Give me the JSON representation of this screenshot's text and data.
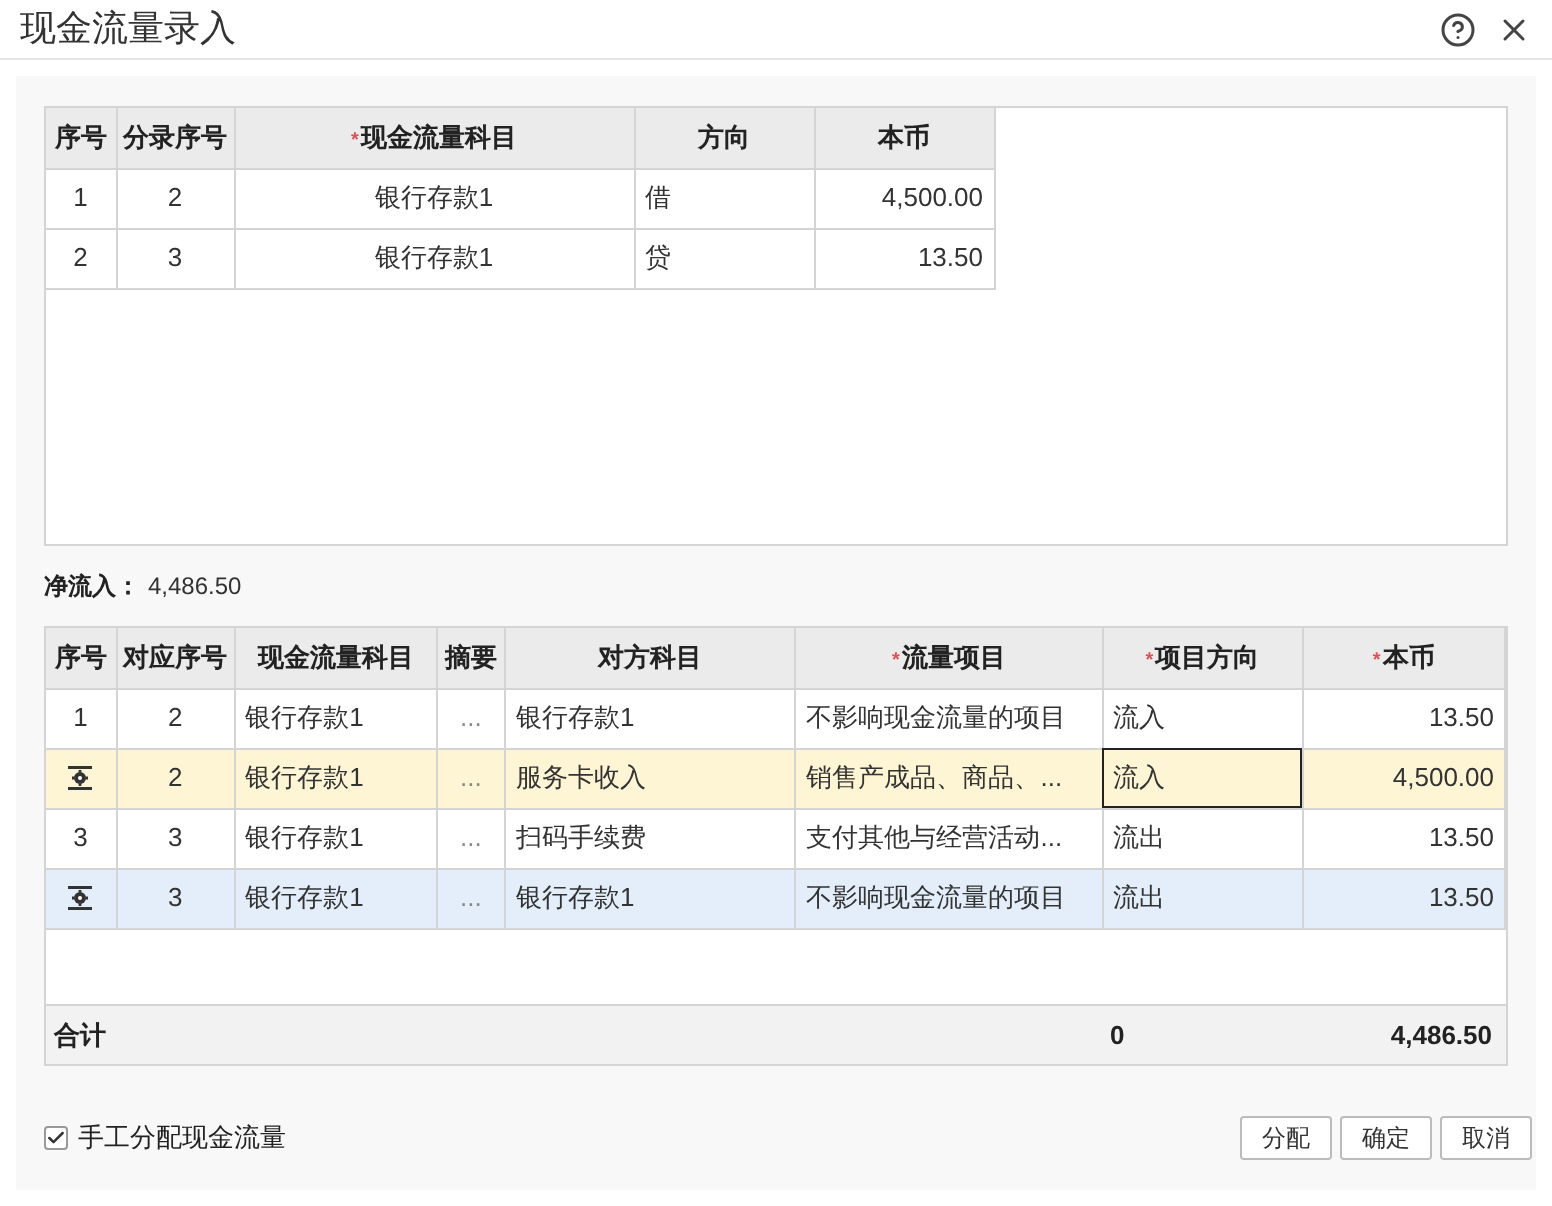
{
  "window": {
    "title": "现金流量录入"
  },
  "entries_table": {
    "columns": [
      {
        "label": "序号"
      },
      {
        "label": "分录序号"
      },
      {
        "label": "现金流量科目",
        "required_mark": "*"
      },
      {
        "label": "方向"
      },
      {
        "label": "本币"
      }
    ],
    "rows": [
      {
        "seq": "1",
        "entry_seq": "2",
        "account": "银行存款1",
        "direction": "借",
        "amount": "4,500.00"
      },
      {
        "seq": "2",
        "entry_seq": "3",
        "account": "银行存款1",
        "direction": "贷",
        "amount": "13.50"
      }
    ]
  },
  "net_inflow": {
    "label": "净流入：",
    "value": "4,486.50"
  },
  "flow_table": {
    "columns": [
      {
        "label": "序号"
      },
      {
        "label": "对应序号"
      },
      {
        "label": "现金流量科目"
      },
      {
        "label": "摘要"
      },
      {
        "label": "对方科目"
      },
      {
        "label": "流量项目",
        "required_mark": "*"
      },
      {
        "label": "项目方向",
        "required_mark": "*"
      },
      {
        "label": "本币",
        "required_mark": "*"
      }
    ],
    "rows": [
      {
        "kind": "number",
        "seq": "1",
        "ref_seq": "2",
        "account": "银行存款1",
        "memo": "...",
        "counter_account": "银行存款1",
        "flow_item": "不影响现金流量的项目",
        "item_direction": "流入",
        "direction_focused": false,
        "amount": "13.50",
        "selected": false,
        "hovered": false
      },
      {
        "kind": "gear",
        "ref_seq": "2",
        "account": "银行存款1",
        "memo": "...",
        "counter_account": "服务卡收入",
        "flow_item": "销售产成品、商品、...",
        "item_direction": "流入",
        "direction_focused": true,
        "amount": "4,500.00",
        "selected": true,
        "hovered": false
      },
      {
        "kind": "number",
        "seq": "3",
        "ref_seq": "3",
        "account": "银行存款1",
        "memo": "...",
        "counter_account": "扫码手续费",
        "flow_item": "支付其他与经营活动...",
        "item_direction": "流出",
        "direction_focused": false,
        "amount": "13.50",
        "selected": false,
        "hovered": false
      },
      {
        "kind": "gear",
        "ref_seq": "3",
        "account": "银行存款1",
        "memo": "...",
        "counter_account": "银行存款1",
        "flow_item": "不影响现金流量的项目",
        "item_direction": "流出",
        "direction_focused": false,
        "amount": "13.50",
        "selected": false,
        "hovered": true
      }
    ],
    "total": {
      "label": "合计",
      "direction_total": "0",
      "amount_total": "4,486.50"
    }
  },
  "manual_allocate": {
    "label": "手工分配现金流量",
    "checked": true
  },
  "buttons": [
    "分配",
    "确定",
    "取消"
  ]
}
